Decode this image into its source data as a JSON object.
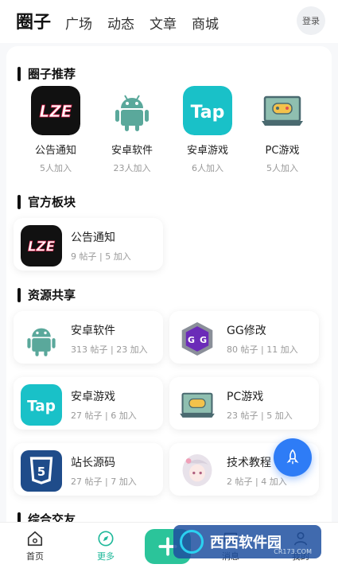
{
  "header": {
    "brand": "圈子",
    "tabs": [
      "广场",
      "动态",
      "文章",
      "商城"
    ],
    "login": "登录"
  },
  "sections": {
    "recommend": "圈子推荐",
    "official": "官方板块",
    "resources": "资源共享",
    "general": "综合交友"
  },
  "recommend_items": [
    {
      "name": "公告通知",
      "count": "5人加入",
      "icon": "lze-logo"
    },
    {
      "name": "安卓软件",
      "count": "23人加入",
      "icon": "android-icon"
    },
    {
      "name": "安卓游戏",
      "count": "6人加入",
      "icon": "taptap-icon"
    },
    {
      "name": "PC游戏",
      "count": "5人加入",
      "icon": "pc-game-icon"
    }
  ],
  "official_items": [
    {
      "name": "公告通知",
      "stats": "9 帖子 | 5 加入",
      "icon": "lze-logo"
    }
  ],
  "resource_items": [
    {
      "name": "安卓软件",
      "stats": "313 帖子 | 23 加入",
      "icon": "android-icon"
    },
    {
      "name": "GG修改",
      "stats": "80 帖子 | 11 加入",
      "icon": "gg-icon"
    },
    {
      "name": "安卓游戏",
      "stats": "27 帖子 | 6 加入",
      "icon": "taptap-icon"
    },
    {
      "name": "PC游戏",
      "stats": "23 帖子 | 5 加入",
      "icon": "pc-game-icon"
    },
    {
      "name": "站长源码",
      "stats": "27 帖子 | 7 加入",
      "icon": "html5-icon"
    },
    {
      "name": "技术教程",
      "stats": "2 帖子 | 4 加入",
      "icon": "anime-avatar"
    }
  ],
  "tabbar": {
    "home": "首页",
    "more": "更多",
    "messages": "消息",
    "mine": "我的",
    "accent": "#1fb89a"
  },
  "watermark": {
    "text": "西西软件园",
    "sub": "CR173.COM"
  },
  "colors": {
    "fab": "#2e7cf6",
    "add_button": "#2bc49a",
    "taptap": "#19c1c8",
    "android": "#3ddc84"
  }
}
